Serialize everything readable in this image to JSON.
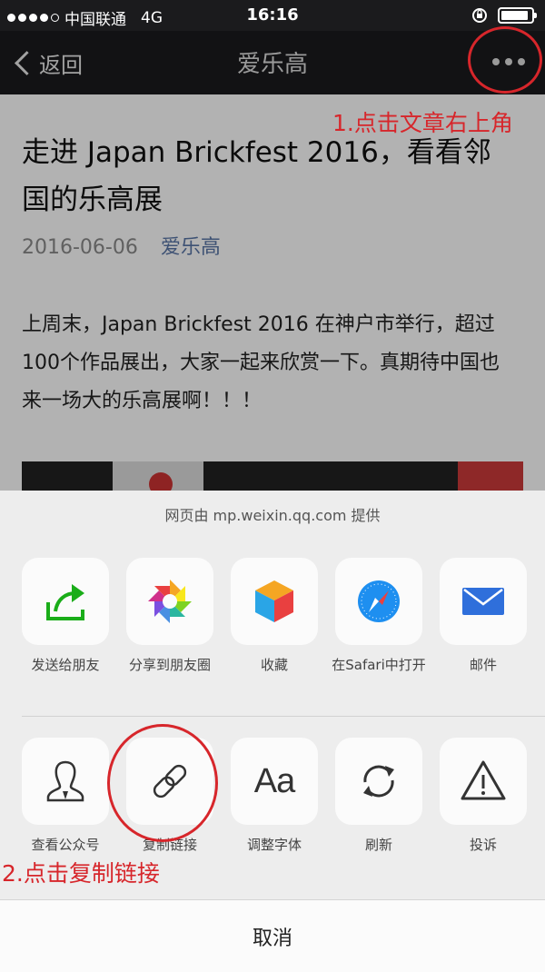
{
  "status_bar": {
    "carrier": "中国联通",
    "network": "4G",
    "time": "16:16",
    "signal_bars": 4,
    "battery_level": 0.9
  },
  "nav": {
    "back_label": "返回",
    "title": "爱乐高"
  },
  "article": {
    "title": "走进 Japan Brickfest 2016，看看邻国的乐高展",
    "date": "2016-06-06",
    "author": "爱乐高",
    "body": "上周末，Japan Brickfest 2016 在神户市举行，超过100个作品展出，大家一起来欣赏一下。真期待中国也来一场大的乐高展啊！！！"
  },
  "share_sheet": {
    "provider": "网页由 mp.weixin.qq.com 提供",
    "row1": [
      {
        "label": "发送给朋友",
        "icon": "share-arrow-icon"
      },
      {
        "label": "分享到朋友圈",
        "icon": "moments-aperture-icon"
      },
      {
        "label": "收藏",
        "icon": "favorites-cube-icon"
      },
      {
        "label": "在Safari中打开",
        "icon": "safari-compass-icon"
      },
      {
        "label": "邮件",
        "icon": "mail-envelope-icon"
      }
    ],
    "row2": [
      {
        "label": "查看公众号",
        "icon": "account-person-icon"
      },
      {
        "label": "复制链接",
        "icon": "link-icon"
      },
      {
        "label": "调整字体",
        "icon": "font-aa-icon"
      },
      {
        "label": "刷新",
        "icon": "refresh-icon"
      },
      {
        "label": "投诉",
        "icon": "warning-icon"
      }
    ],
    "cancel_label": "取消"
  },
  "annotations": {
    "step1": "1.点击文章右上角",
    "step2": "2.点击复制链接",
    "color": "#d7262b"
  }
}
